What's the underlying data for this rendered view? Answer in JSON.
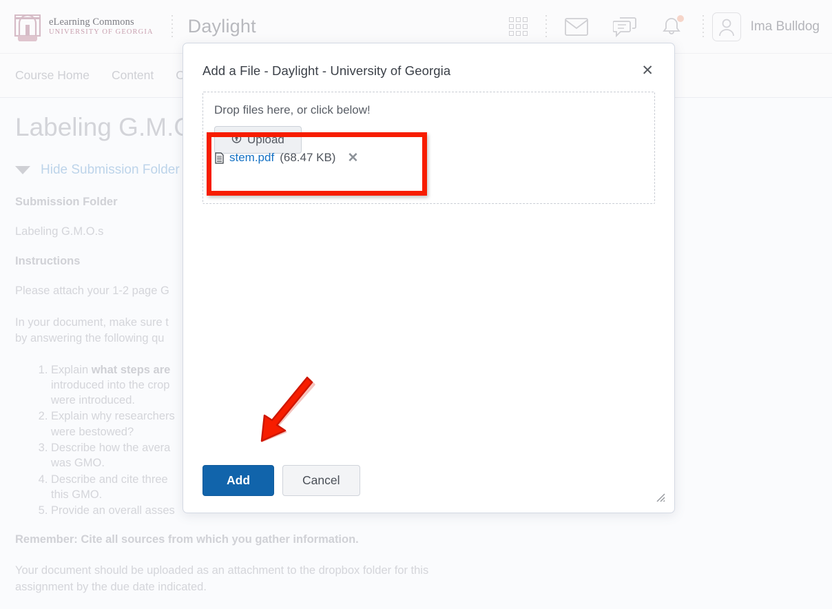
{
  "header": {
    "brand": {
      "logo_icon": "uga-arch-logo-icon",
      "line1": "eLearning Commons",
      "line2": "UNIVERSITY OF GEORGIA"
    },
    "app_title": "Daylight",
    "icons": [
      {
        "name": "apps-grid-icon",
        "label": "Course Selector"
      },
      {
        "name": "envelope-icon",
        "label": "Email"
      },
      {
        "name": "chat-bubble-icon",
        "label": "Messages"
      },
      {
        "name": "bell-icon",
        "label": "Notifications",
        "has_badge": true
      }
    ],
    "user": {
      "avatar_icon": "user-avatar-icon",
      "name": "Ima Bulldog"
    }
  },
  "nav": {
    "items": [
      {
        "label": "Course Home"
      },
      {
        "label": "Content"
      },
      {
        "label": "Cla"
      }
    ]
  },
  "page": {
    "title": "Labeling G.M.O",
    "toggle": {
      "caret_icon": "caret-down-icon",
      "label": "Hide Submission Folder In"
    },
    "submission_heading": "Submission Folder",
    "submission_name": "Labeling G.M.O.s",
    "instructions_heading": "Instructions",
    "para1": "Please attach your 1-2 page G",
    "para2_line1": "In your document, make sure t",
    "para2_line2": "by answering the following qu",
    "list": [
      {
        "pre": "Explain ",
        "bold": "what steps are ",
        "rest": "",
        "lines": [
          "introduced into the crop",
          "were introduced."
        ]
      },
      {
        "pre": "Explain why researchers",
        "bold": "",
        "rest": "",
        "lines": [
          "were bestowed?"
        ]
      },
      {
        "pre": "Describe how the avera",
        "bold": "",
        "rest": "",
        "lines": [
          "was GMO."
        ]
      },
      {
        "pre": "Describe and cite three",
        "bold": "",
        "rest": "",
        "lines": [
          "this GMO."
        ]
      },
      {
        "pre": "Provide an overall asses",
        "bold": "",
        "rest": "",
        "lines": []
      }
    ],
    "remember": "Remember: Cite all sources from which you gather information.",
    "closing_line1": "Your document should be uploaded as an attachment to the dropbox folder for this",
    "closing_line2": "assignment by the due date indicated."
  },
  "dialog": {
    "title": "Add a File - Daylight - University of Georgia",
    "close_icon": "close-icon",
    "close_label": "✕",
    "dropzone": {
      "label": "Drop files here, or click below!",
      "upload_icon": "upload-cloud-icon",
      "upload_label": "Upload"
    },
    "file": {
      "doc_icon": "document-file-icon",
      "name": "stem.pdf",
      "size": "(68.47 KB)",
      "remove_icon": "remove-file-icon",
      "remove_label": "✕"
    },
    "footer": {
      "add_label": "Add",
      "cancel_label": "Cancel",
      "resize_icon": "resize-grip-icon"
    }
  },
  "annotations": {
    "highlight_box": {
      "name": "file-row-highlight",
      "color": "#F71D00"
    },
    "arrow": {
      "name": "pointer-arrow",
      "color": "#F71D00",
      "points_to": "Add"
    }
  },
  "colors": {
    "accent_blue": "#1164AB",
    "link_blue": "#1471C4",
    "annotation_red": "#F71D00",
    "uga_red": "#BA0C2F"
  }
}
